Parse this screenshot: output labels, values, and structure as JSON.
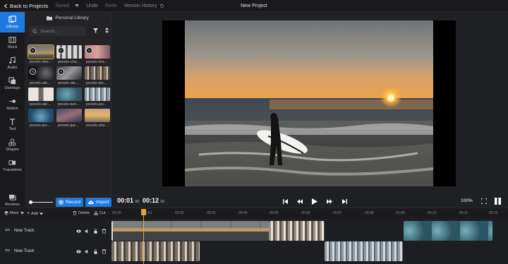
{
  "topbar": {
    "back_label": "Back to Projects",
    "saved_label": "Saved",
    "undo_label": "Undo",
    "redo_label": "Redo",
    "version_history_label": "Version History",
    "project_title": "New Project"
  },
  "nav": {
    "items": [
      {
        "label": "Library",
        "icon": "library-icon"
      },
      {
        "label": "Stock",
        "icon": "stock-icon"
      },
      {
        "label": "Audio",
        "icon": "music-icon"
      },
      {
        "label": "Overlays",
        "icon": "overlays-icon"
      },
      {
        "label": "Motion",
        "icon": "motion-icon"
      },
      {
        "label": "Text",
        "icon": "text-icon"
      },
      {
        "label": "Shapes",
        "icon": "shapes-icon"
      },
      {
        "label": "Transitions",
        "icon": "transitions-icon"
      },
      {
        "label": "Reviews",
        "icon": "reviews-icon"
      }
    ]
  },
  "library": {
    "header": "Personal Library",
    "search_placeholder": "Search...",
    "items": [
      {
        "label": "pexels-ebe...",
        "badge": "0"
      },
      {
        "label": "pexels-cha...",
        "badge": "0"
      },
      {
        "label": "pexels-bra...",
        "badge": "0"
      },
      {
        "label": "pexels-ale...",
        "badge": "0"
      },
      {
        "label": "pexels-ale...",
        "badge": "0"
      },
      {
        "label": "pexels-jos...",
        "badge": ""
      },
      {
        "label": "pexels-ale...",
        "badge": ""
      },
      {
        "label": "pexels-ken...",
        "badge": ""
      },
      {
        "label": "pexels-jos...",
        "badge": ""
      },
      {
        "label": "pexels-jos...",
        "badge": ""
      },
      {
        "label": "pexels-jiar...",
        "badge": ""
      },
      {
        "label": "pexels-zha...",
        "badge": ""
      }
    ],
    "record_label": "Record",
    "import_label": "Import"
  },
  "player": {
    "current_time": "00:01",
    "current_frames": "00",
    "total_time": "00:12",
    "total_frames": "02",
    "zoom": "100%"
  },
  "timeline": {
    "more_label": "More",
    "add_label": "Add",
    "delete_label": "Delete",
    "cut_label": "Cut",
    "ruler": [
      "00:00",
      "00:01",
      "00:02",
      "00:03",
      "00:04",
      "00:05",
      "00:06",
      "00:07",
      "00:08",
      "00:09",
      "00:10",
      "00:11",
      "00:12"
    ],
    "tracks": [
      {
        "name": "New Track"
      },
      {
        "name": "New Track"
      }
    ]
  },
  "colors": {
    "accent": "#1f7ae0",
    "playhead": "#e5a32a"
  }
}
